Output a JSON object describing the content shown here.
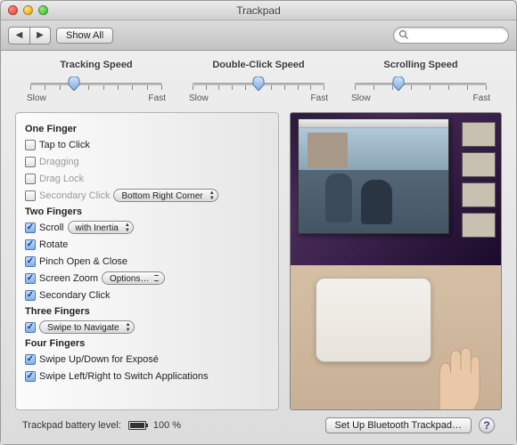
{
  "title": "Trackpad",
  "toolbar": {
    "show_all": "Show All",
    "search_value": "",
    "search_placeholder": ""
  },
  "sliders": {
    "tracking": {
      "title": "Tracking Speed",
      "slow": "Slow",
      "fast": "Fast",
      "position_pct": 33
    },
    "doubleclick": {
      "title": "Double-Click Speed",
      "slow": "Slow",
      "fast": "Fast",
      "position_pct": 50
    },
    "scrolling": {
      "title": "Scrolling Speed",
      "slow": "Slow",
      "fast": "Fast",
      "position_pct": 33
    }
  },
  "sections": {
    "one_finger": {
      "title": "One Finger",
      "tap_to_click": {
        "label": "Tap to Click",
        "checked": false,
        "enabled": true
      },
      "dragging": {
        "label": "Dragging",
        "checked": false,
        "enabled": false
      },
      "drag_lock": {
        "label": "Drag Lock",
        "checked": false,
        "enabled": false
      },
      "secondary_click": {
        "label": "Secondary Click",
        "checked": false,
        "enabled": false,
        "select_value": "Bottom Right Corner"
      }
    },
    "two_fingers": {
      "title": "Two Fingers",
      "scroll": {
        "label": "Scroll",
        "checked": true,
        "select_value": "with Inertia"
      },
      "rotate": {
        "label": "Rotate",
        "checked": true
      },
      "pinch": {
        "label": "Pinch Open & Close",
        "checked": true
      },
      "screen_zoom": {
        "label": "Screen Zoom",
        "checked": true,
        "button": "Options…"
      },
      "secondary_click": {
        "label": "Secondary Click",
        "checked": true
      }
    },
    "three_fingers": {
      "title": "Three Fingers",
      "swipe_nav": {
        "checked": true,
        "select_value": "Swipe to Navigate"
      }
    },
    "four_fingers": {
      "title": "Four Fingers",
      "expose": {
        "label": "Swipe Up/Down for Exposé",
        "checked": true
      },
      "switch_apps": {
        "label": "Swipe Left/Right to Switch Applications",
        "checked": true
      }
    }
  },
  "bottom": {
    "battery_label": "Trackpad battery level:",
    "battery_pct": "100 %",
    "setup_button": "Set Up Bluetooth Trackpad…",
    "help": "?"
  }
}
